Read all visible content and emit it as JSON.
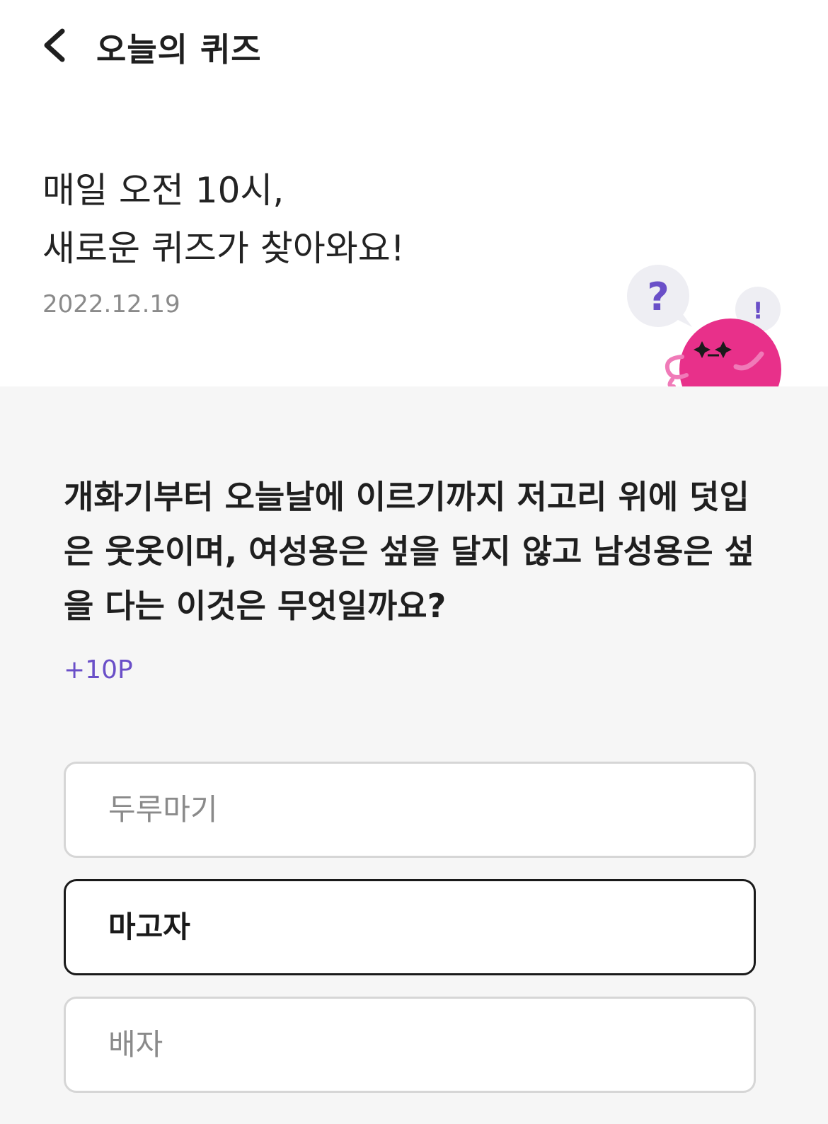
{
  "header": {
    "title": "오늘의 퀴즈",
    "back_icon": "chevron-left-icon"
  },
  "intro": {
    "line1": "매일 오전 10시,",
    "line2": "새로운 퀴즈가 찾아와요!",
    "date": "2022.12.19"
  },
  "mascot": {
    "question_mark": "?",
    "exclamation_mark": "!",
    "body_color": "#e8308a",
    "accent_color": "#6a4fc8"
  },
  "quiz": {
    "question": "개화기부터 오늘날에 이르기까지 저고리 위에 덧입은 웃옷이며, 여성용은 섶을 달지 않고 남성용은 섶을 다는 이것은 무엇일까요?",
    "points": "+10P",
    "options": [
      {
        "label": "두루마기",
        "selected": false
      },
      {
        "label": "마고자",
        "selected": true
      },
      {
        "label": "배자",
        "selected": false
      }
    ]
  }
}
